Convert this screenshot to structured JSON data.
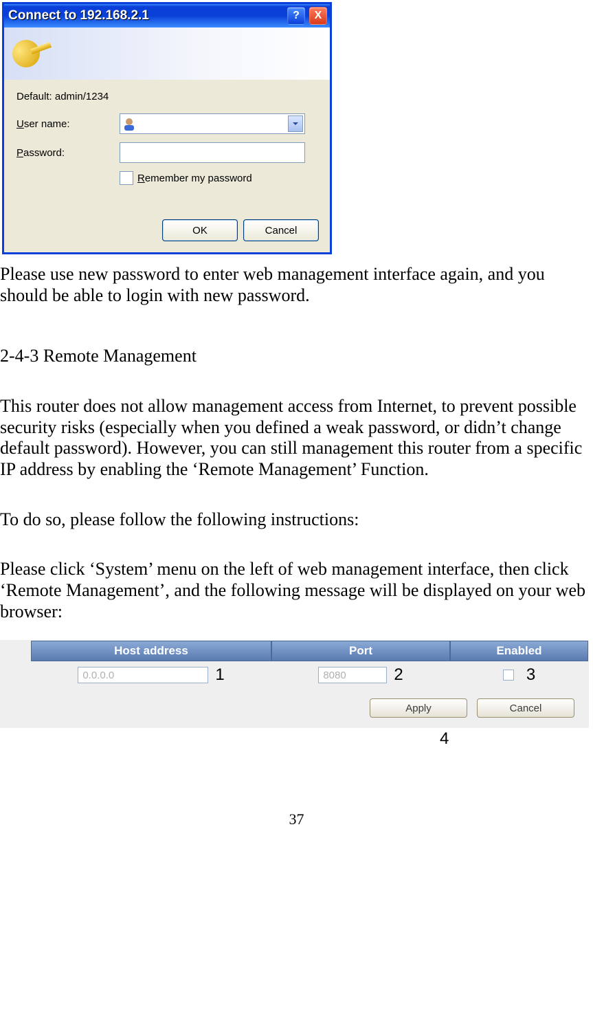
{
  "dialog": {
    "title": "Connect to 192.168.2.1",
    "hint": "Default: admin/1234",
    "username_label_pre": "U",
    "username_label_post": "ser name:",
    "password_label_pre": "P",
    "password_label_post": "assword:",
    "remember_pre": "R",
    "remember_post": "emember my password",
    "ok": "OK",
    "cancel": "Cancel",
    "help_char": "?",
    "close_char": "X"
  },
  "doc": {
    "p1": "Please use new password to enter web management interface again, and you should be able to login with new password.",
    "heading": "2-4-3 Remote Management",
    "p2": "This router does not allow management access from Internet, to prevent possible security risks (especially when you defined a weak password, or didn’t change default password). However, you can still management this router from a specific IP address by enabling the ‘Remote Management’ Function.",
    "p3": "To do so, please follow the following instructions:",
    "p4": "Please click ‘System’ menu on the left of web management interface, then click ‘Remote Management’, and the following message will be displayed on your web browser:"
  },
  "rm": {
    "head_host": "Host address",
    "head_port": "Port",
    "head_enabled": "Enabled",
    "host_placeholder": "0.0.0.0",
    "port_placeholder": "8080",
    "n1": "1",
    "n2": "2",
    "n3": "3",
    "n4": "4",
    "apply": "Apply",
    "cancel": "Cancel"
  },
  "page_number": "37"
}
